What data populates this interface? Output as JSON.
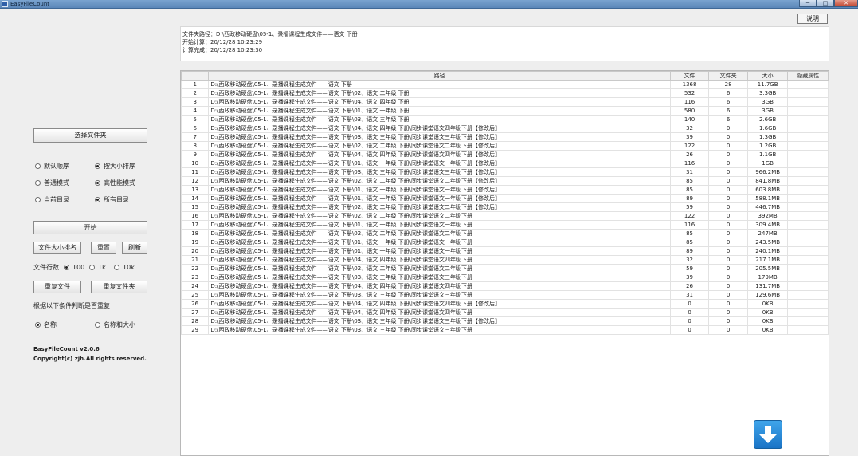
{
  "window": {
    "title": "EasyFileCount",
    "minimize": "─",
    "maximize": "□",
    "close": "✕"
  },
  "help_button": "说明",
  "info": {
    "line1": "文件夹路径：D:\\西政移动硬盘\\05-1、录播课程生成文件——语文 下册",
    "line2": "开始计算：20/12/28 10:23:29",
    "line3": "计算完成：20/12/28 10:23:30"
  },
  "left": {
    "select_folder": "选择文件夹",
    "order_default": "默认顺序",
    "order_size": "按大小排序",
    "mode_normal": "普通模式",
    "mode_fast": "高性能模式",
    "dir_current": "当前目录",
    "dir_all": "所有目录",
    "start": "开始",
    "file_size_sort": "文件大小排名",
    "reset": "重置",
    "refresh": "刷新",
    "rows_label": "文件行数",
    "rows_100": "100",
    "rows_1k": "1k",
    "rows_10k": "10k",
    "dup_files": "重复文件",
    "dup_folders": "重复文件夹",
    "dup_criteria": "根据以下条件判断是否重复",
    "crit_name": "名称",
    "crit_name_size": "名称和大小",
    "version": "EasyFileCount v2.0.6",
    "copyright": "Copyright(c) zjh.All rights reserved."
  },
  "table": {
    "headers": [
      "",
      "路径",
      "文件",
      "文件夹",
      "大小",
      "隐藏属性"
    ],
    "rows": [
      [
        "1",
        "D:\\西政移动硬盘\\05-1、录播课程生成文件——语文 下册",
        "1368",
        "28",
        "11.7GB",
        ""
      ],
      [
        "2",
        "D:\\西政移动硬盘\\05-1、录播课程生成文件——语文 下册\\02、语文 二年级 下册",
        "532",
        "6",
        "3.3GB",
        ""
      ],
      [
        "3",
        "D:\\西政移动硬盘\\05-1、录播课程生成文件——语文 下册\\04、语文 四年级 下册",
        "116",
        "6",
        "3GB",
        ""
      ],
      [
        "4",
        "D:\\西政移动硬盘\\05-1、录播课程生成文件——语文 下册\\01、语文 一年级 下册",
        "580",
        "6",
        "3GB",
        ""
      ],
      [
        "5",
        "D:\\西政移动硬盘\\05-1、录播课程生成文件——语文 下册\\03、语文 三年级 下册",
        "140",
        "6",
        "2.6GB",
        ""
      ],
      [
        "6",
        "D:\\西政移动硬盘\\05-1、录播课程生成文件——语文 下册\\04、语文 四年级 下册\\同步课堂语文四年级下册【修改后】",
        "32",
        "0",
        "1.6GB",
        ""
      ],
      [
        "7",
        "D:\\西政移动硬盘\\05-1、录播课程生成文件——语文 下册\\03、语文 三年级 下册\\同步课堂语文三年级下册【修改后】",
        "39",
        "0",
        "1.3GB",
        ""
      ],
      [
        "8",
        "D:\\西政移动硬盘\\05-1、录播课程生成文件——语文 下册\\02、语文 二年级 下册\\同步课堂语文二年级下册【修改后】",
        "122",
        "0",
        "1.2GB",
        ""
      ],
      [
        "9",
        "D:\\西政移动硬盘\\05-1、录播课程生成文件——语文 下册\\04、语文 四年级 下册\\同步课堂语文四年级下册【修改后】",
        "26",
        "0",
        "1.1GB",
        ""
      ],
      [
        "10",
        "D:\\西政移动硬盘\\05-1、录播课程生成文件——语文 下册\\01、语文 一年级 下册\\同步课堂语文一年级下册【修改后】",
        "116",
        "0",
        "1GB",
        ""
      ],
      [
        "11",
        "D:\\西政移动硬盘\\05-1、录播课程生成文件——语文 下册\\03、语文 三年级 下册\\同步课堂语文三年级下册【修改后】",
        "31",
        "0",
        "966.2MB",
        ""
      ],
      [
        "12",
        "D:\\西政移动硬盘\\05-1、录播课程生成文件——语文 下册\\02、语文 二年级 下册\\同步课堂语文二年级下册【修改后】",
        "85",
        "0",
        "841.8MB",
        ""
      ],
      [
        "13",
        "D:\\西政移动硬盘\\05-1、录播课程生成文件——语文 下册\\01、语文 一年级 下册\\同步课堂语文一年级下册【修改后】",
        "85",
        "0",
        "603.8MB",
        ""
      ],
      [
        "14",
        "D:\\西政移动硬盘\\05-1、录播课程生成文件——语文 下册\\01、语文 一年级 下册\\同步课堂语文一年级下册【修改后】",
        "89",
        "0",
        "588.1MB",
        ""
      ],
      [
        "15",
        "D:\\西政移动硬盘\\05-1、录播课程生成文件——语文 下册\\02、语文 二年级 下册\\同步课堂语文二年级下册【修改后】",
        "59",
        "0",
        "446.7MB",
        ""
      ],
      [
        "16",
        "D:\\西政移动硬盘\\05-1、录播课程生成文件——语文 下册\\02、语文 二年级 下册\\同步课堂语文二年级下册",
        "122",
        "0",
        "392MB",
        ""
      ],
      [
        "17",
        "D:\\西政移动硬盘\\05-1、录播课程生成文件——语文 下册\\01、语文 一年级 下册\\同步课堂语文一年级下册",
        "116",
        "0",
        "309.4MB",
        ""
      ],
      [
        "18",
        "D:\\西政移动硬盘\\05-1、录播课程生成文件——语文 下册\\02、语文 二年级 下册\\同步课堂语文二年级下册",
        "85",
        "0",
        "247MB",
        ""
      ],
      [
        "19",
        "D:\\西政移动硬盘\\05-1、录播课程生成文件——语文 下册\\01、语文 一年级 下册\\同步课堂语文一年级下册",
        "85",
        "0",
        "243.5MB",
        ""
      ],
      [
        "20",
        "D:\\西政移动硬盘\\05-1、录播课程生成文件——语文 下册\\01、语文 一年级 下册\\同步课堂语文一年级下册",
        "89",
        "0",
        "240.1MB",
        ""
      ],
      [
        "21",
        "D:\\西政移动硬盘\\05-1、录播课程生成文件——语文 下册\\04、语文 四年级 下册\\同步课堂语文四年级下册",
        "32",
        "0",
        "217.1MB",
        ""
      ],
      [
        "22",
        "D:\\西政移动硬盘\\05-1、录播课程生成文件——语文 下册\\02、语文 二年级 下册\\同步课堂语文二年级下册",
        "59",
        "0",
        "205.5MB",
        ""
      ],
      [
        "23",
        "D:\\西政移动硬盘\\05-1、录播课程生成文件——语文 下册\\03、语文 三年级 下册\\同步课堂语文三年级下册",
        "39",
        "0",
        "179MB",
        ""
      ],
      [
        "24",
        "D:\\西政移动硬盘\\05-1、录播课程生成文件——语文 下册\\04、语文 四年级 下册\\同步课堂语文四年级下册",
        "26",
        "0",
        "131.7MB",
        ""
      ],
      [
        "25",
        "D:\\西政移动硬盘\\05-1、录播课程生成文件——语文 下册\\03、语文 三年级 下册\\同步课堂语文三年级下册",
        "31",
        "0",
        "129.6MB",
        ""
      ],
      [
        "26",
        "D:\\西政移动硬盘\\05-1、录播课程生成文件——语文 下册\\04、语文 四年级 下册\\同步课堂语文四年级下册【修改后】",
        "0",
        "0",
        "0KB",
        ""
      ],
      [
        "27",
        "D:\\西政移动硬盘\\05-1、录播课程生成文件——语文 下册\\04、语文 四年级 下册\\同步课堂语文四年级下册",
        "0",
        "0",
        "0KB",
        ""
      ],
      [
        "28",
        "D:\\西政移动硬盘\\05-1、录播课程生成文件——语文 下册\\03、语文 三年级 下册\\同步课堂语文三年级下册【修改后】",
        "0",
        "0",
        "0KB",
        ""
      ],
      [
        "29",
        "D:\\西政移动硬盘\\05-1、录播课程生成文件——语文 下册\\03、语文 三年级 下册\\同步课堂语文三年级下册",
        "0",
        "0",
        "0KB",
        ""
      ]
    ]
  },
  "colors": {
    "accent": "#1a74c6",
    "background": "#eeeeee"
  },
  "icons": {
    "download": "down-arrow-icon",
    "app": "app-icon"
  }
}
